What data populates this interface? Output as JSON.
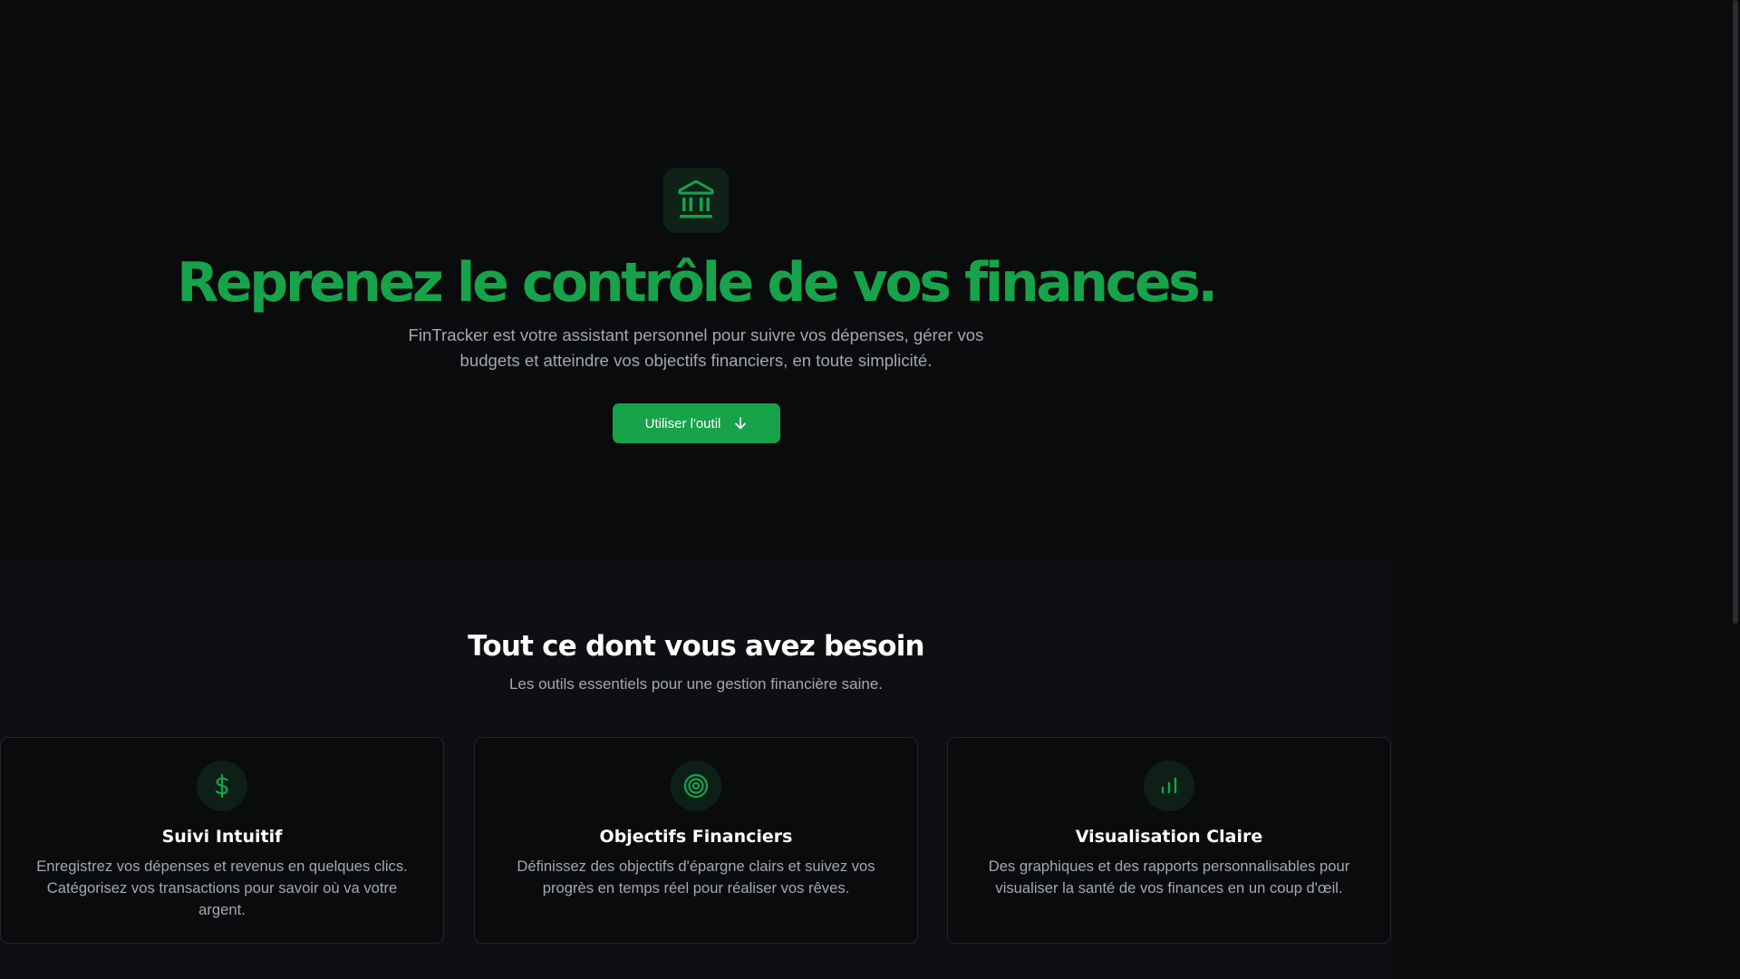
{
  "colors": {
    "accent": "#16a34a",
    "hero_title": "#16a34a",
    "background": "#0a0b0d",
    "section_background": "#0e0f12",
    "muted_text": "#a3a8b0",
    "card_border": "#24262b"
  },
  "hero": {
    "icon": "bank-icon",
    "title": "Reprenez le contrôle de vos finances.",
    "subtitle": "FinTracker est votre assistant personnel pour suivre vos dépenses, gérer vos budgets et atteindre vos objectifs financiers, en toute simplicité.",
    "cta_label": "Utiliser l'outil",
    "cta_icon": "arrow-down-icon"
  },
  "features": {
    "title": "Tout ce dont vous avez besoin",
    "subtitle": "Les outils essentiels pour une gestion financière saine.",
    "cards": [
      {
        "icon": "dollar-icon",
        "title": "Suivi Intuitif",
        "description": "Enregistrez vos dépenses et revenus en quelques clics. Catégorisez vos transactions pour savoir où va votre argent."
      },
      {
        "icon": "target-icon",
        "title": "Objectifs Financiers",
        "description": "Définissez des objectifs d'épargne clairs et suivez vos progrès en temps réel pour réaliser vos rêves."
      },
      {
        "icon": "bar-chart-icon",
        "title": "Visualisation Claire",
        "description": "Des graphiques et des rapports personnalisables pour visualiser la santé de vos finances en un coup d'œil."
      }
    ]
  }
}
